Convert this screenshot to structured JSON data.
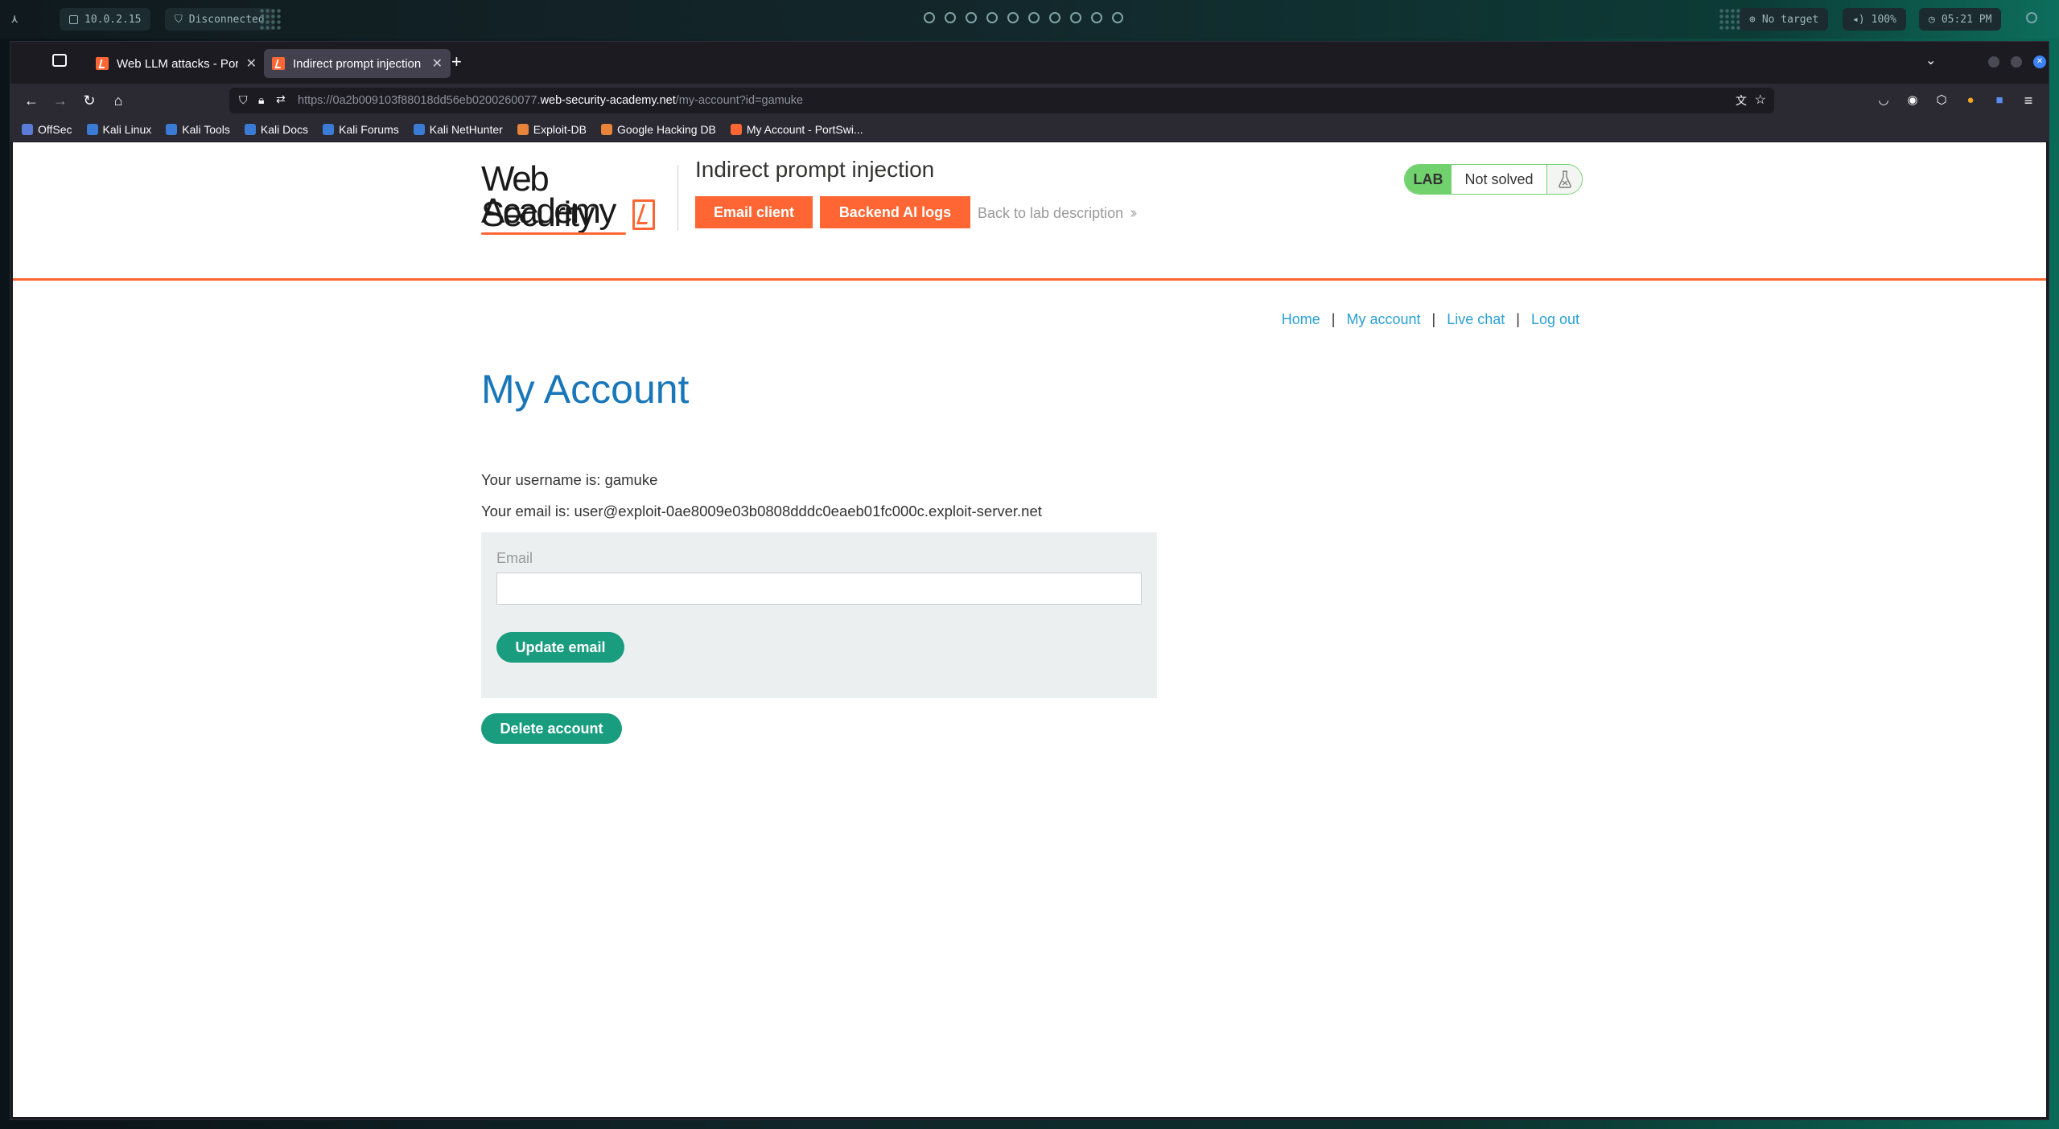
{
  "os_bar": {
    "ip": "10.0.2.15",
    "vpn_status": "Disconnected",
    "target": "No target",
    "volume": "100%",
    "clock": "05:21 PM"
  },
  "tabs": [
    {
      "title": "Web LLM attacks - PortSwi",
      "active": false
    },
    {
      "title": "Indirect prompt injection",
      "active": true
    }
  ],
  "url": {
    "prefix": "https://0a2b009103f88018dd56eb0200260077.",
    "host": "web-security-academy.net",
    "path": "/my-account?id=gamuke"
  },
  "bookmarks": [
    {
      "label": "OffSec",
      "color": "#5a7bd8"
    },
    {
      "label": "Kali Linux",
      "color": "#3a7bd5"
    },
    {
      "label": "Kali Tools",
      "color": "#3a7bd5"
    },
    {
      "label": "Kali Docs",
      "color": "#3a7bd5"
    },
    {
      "label": "Kali Forums",
      "color": "#3a7bd5"
    },
    {
      "label": "Kali NetHunter",
      "color": "#3a7bd5"
    },
    {
      "label": "Exploit-DB",
      "color": "#e8833a"
    },
    {
      "label": "Google Hacking DB",
      "color": "#e8833a"
    },
    {
      "label": "My Account - PortSwi...",
      "color": "#ff6633"
    }
  ],
  "header": {
    "logo_line1": "Web Security",
    "logo_line2": "Academy",
    "lab_title": "Indirect prompt injection",
    "email_client": "Email client",
    "backend_logs": "Backend AI logs",
    "back_link": "Back to lab description",
    "status_lab": "LAB",
    "status_text": "Not solved"
  },
  "nav": {
    "home": "Home",
    "my_account": "My account",
    "live_chat": "Live chat",
    "log_out": "Log out",
    "separator": "|"
  },
  "account": {
    "heading": "My Account",
    "username_line": "Your username is: gamuke",
    "email_line": "Your email is: user@exploit-0ae8009e03b0808dddc0eaeb01fc000c.exploit-server.net",
    "email_label": "Email",
    "email_value": "",
    "update_button": "Update email",
    "delete_button": "Delete account"
  },
  "colors": {
    "accent_orange": "#ff6633",
    "link_blue": "#29a0d4",
    "heading_blue": "#1977b9",
    "button_green": "#1a9d7f",
    "lab_green": "#70d16d"
  }
}
